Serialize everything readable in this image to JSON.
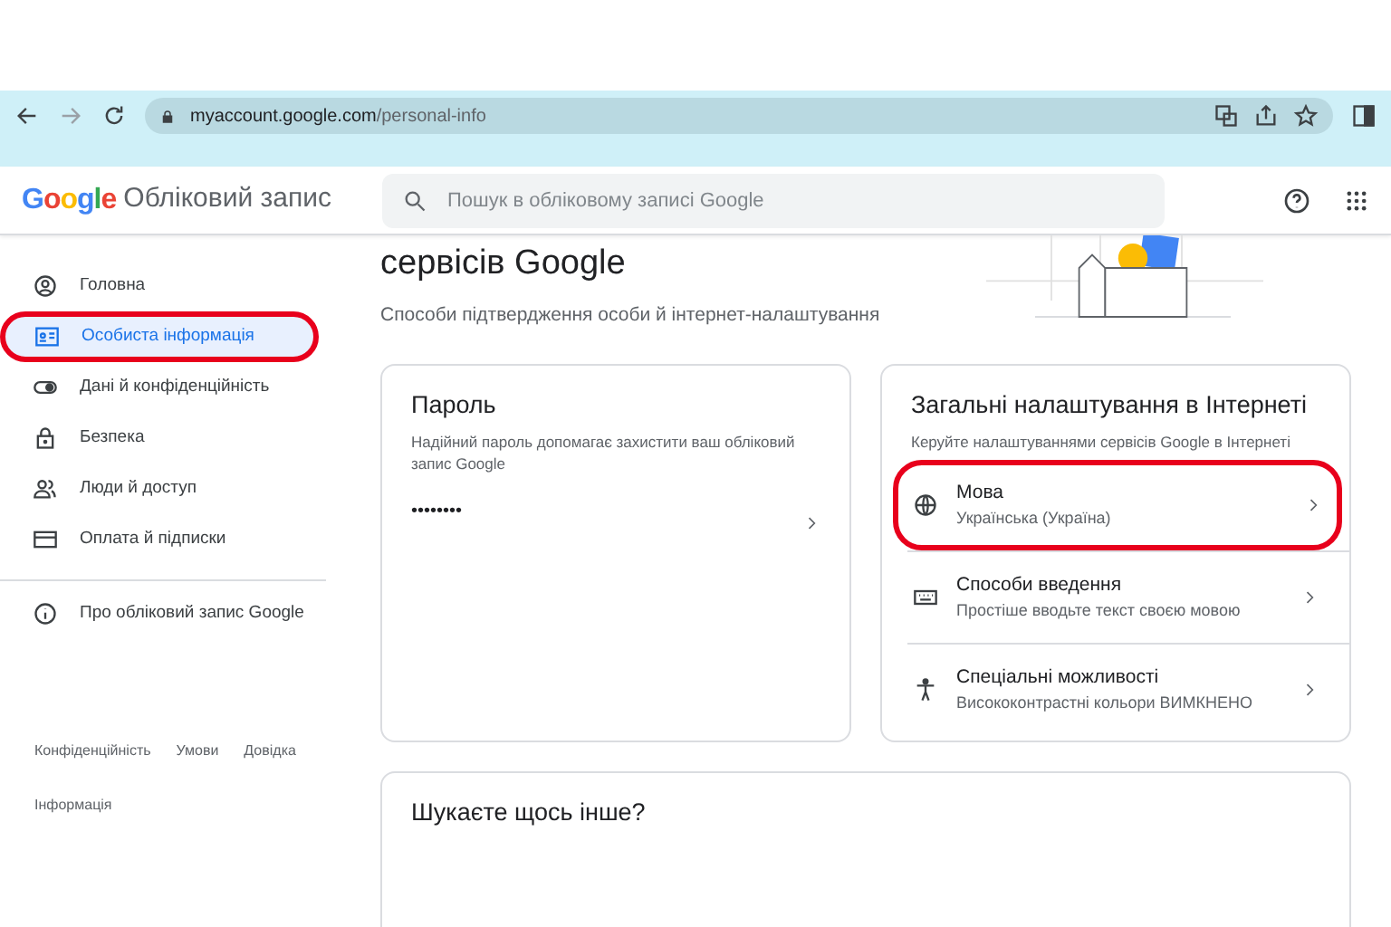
{
  "browser": {
    "forward_disabled": true,
    "url_host": "myaccount.google.com",
    "url_path": "/personal-info"
  },
  "header": {
    "logo": "Google",
    "title": "Обліковий запис",
    "search": {
      "placeholder": "Пошук в обліковому записі Google"
    }
  },
  "sidebar": {
    "items": [
      {
        "label": "Головна",
        "selected": false,
        "highlighted": false
      },
      {
        "label": "Особиста інформація",
        "selected": true,
        "highlighted": true
      },
      {
        "label": "Дані й конфіденційність",
        "selected": false,
        "highlighted": false
      },
      {
        "label": "Безпека",
        "selected": false,
        "highlighted": false
      },
      {
        "label": "Люди й доступ",
        "selected": false,
        "highlighted": false
      },
      {
        "label": "Оплата й підписки",
        "selected": false,
        "highlighted": false
      }
    ],
    "about": {
      "label": "Про обліковий запис Google"
    },
    "footer_links": [
      "Конфіденційність",
      "Умови",
      "Довідка",
      "Інформація"
    ]
  },
  "main": {
    "heading": "сервісів Google",
    "subheading": "Способи підтвердження особи й інтернет-налаштування",
    "password_card": {
      "title": "Пароль",
      "description": "Надійний пароль допомагає захистити ваш обліковий запис Google",
      "value": "••••••••"
    },
    "web_card": {
      "title": "Загальні налаштування в Інтернеті",
      "description": "Керуйте налаштуваннями сервісів Google в Інтернеті",
      "rows": [
        {
          "title": "Мова",
          "subtitle": "Українська (Україна)",
          "highlighted": true
        },
        {
          "title": "Способи введення",
          "subtitle": "Простіше вводьте текст своєю мовою",
          "highlighted": false
        },
        {
          "title": "Спеціальні можливості",
          "subtitle": "Висококонтрастні кольори ВИМКНЕНО",
          "highlighted": false
        }
      ]
    },
    "other_card": {
      "title": "Шукаєте щось інше?"
    }
  }
}
